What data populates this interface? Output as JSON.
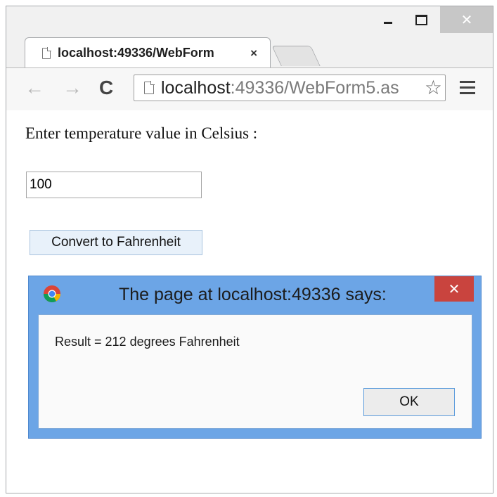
{
  "window": {
    "minimize_icon": "minimize-icon",
    "maximize_icon": "maximize-icon",
    "close_glyph": "✕"
  },
  "tab": {
    "title": "localhost:49336/WebForm",
    "close_glyph": "×"
  },
  "toolbar": {
    "back_glyph": "←",
    "forward_glyph": "→",
    "reload_glyph": "C",
    "url_host": "localhost",
    "url_rest": ":49336/WebForm5.as",
    "star_glyph": "☆"
  },
  "page": {
    "prompt": "Enter temperature value in Celsius :",
    "input_value": "100",
    "convert_button": "Convert to Fahrenheit"
  },
  "dialog": {
    "title": "The page at localhost:49336 says:",
    "close_glyph": "✕",
    "message": "Result = 212 degrees Fahrenheit",
    "ok_label": "OK"
  },
  "colors": {
    "dialog_frame": "#6ca5e6",
    "dialog_close": "#c9443e",
    "button_face": "#e8f1fa"
  }
}
